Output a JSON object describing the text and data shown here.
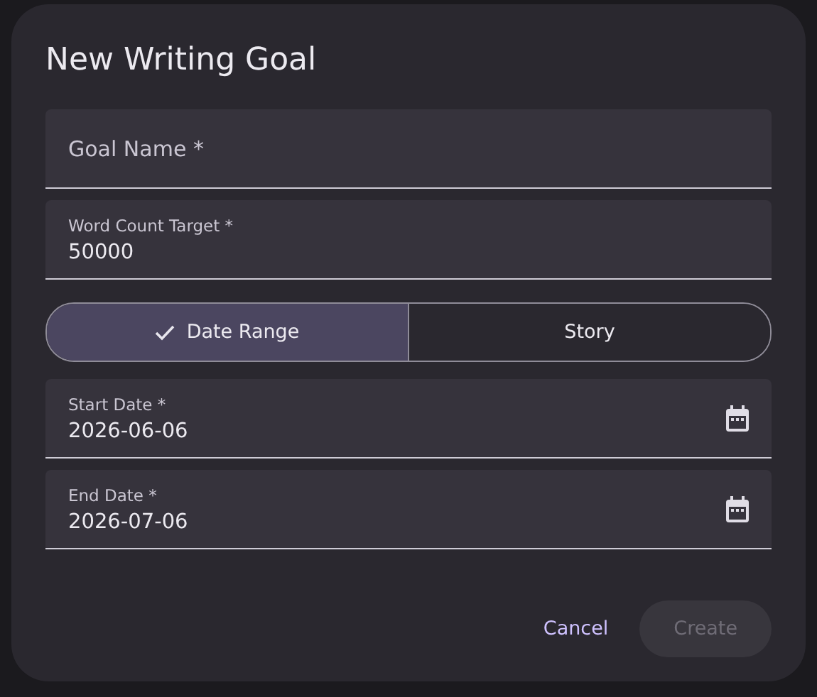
{
  "dialog": {
    "title": "New Writing Goal",
    "fields": [
      {
        "label": "Goal Name *"
      },
      {
        "label": "Word Count Target *",
        "value": "50000"
      }
    ],
    "toggle": [
      {
        "label": "Date Range",
        "selected": true
      },
      {
        "label": "Story",
        "selected": false
      }
    ],
    "date_fields": [
      {
        "kind": "date",
        "label": "Start Date *",
        "value": "2026-06-06"
      },
      {
        "kind": "date",
        "label": "End Date *",
        "value": "2026-07-06"
      }
    ],
    "buttons": [
      {
        "label": "Cancel",
        "kind": "text",
        "disabled": false
      },
      {
        "label": "Create",
        "kind": "filled",
        "disabled": true
      }
    ]
  }
}
